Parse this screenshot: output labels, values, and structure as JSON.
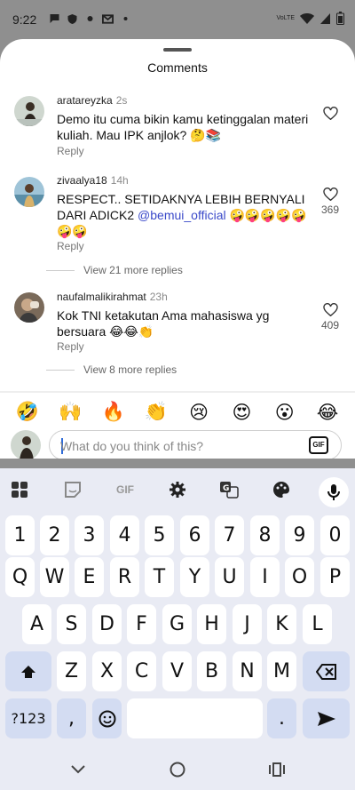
{
  "status_bar": {
    "time": "9:22",
    "network": "VoLTE",
    "left_icons": [
      "chat-icon",
      "vpn-icon",
      "dot-icon",
      "gmail-icon",
      "notification-dot-icon"
    ],
    "right_icons": [
      "volte-icon",
      "wifi-icon",
      "signal-icon",
      "battery-icon"
    ]
  },
  "sheet": {
    "title": "Comments"
  },
  "comments": [
    {
      "username": "aratareyzka",
      "time": "2s",
      "text": "Demo itu cuma bikin kamu ketinggalan materi kuliah. Mau IPK anjlok? 🤔📚",
      "mention": "",
      "reply_label": "Reply",
      "likes": "",
      "view_more": ""
    },
    {
      "username": "zivaalya18",
      "time": "14h",
      "text": "RESPECT.. SETIDAKNYA LEBIH BERNYALI DARI ADICK2 ",
      "mention": "@bemui_official",
      "text_after": " 🤪🤪🤪🤪🤪🤪🤪",
      "reply_label": "Reply",
      "likes": "369",
      "view_more": "View 21 more replies"
    },
    {
      "username": "naufalmalikirahmat",
      "time": "23h",
      "text": "Kok TNI ketakutan Ama mahasiswa yg bersuara 😂😂👏",
      "mention": "",
      "reply_label": "Reply",
      "likes": "409",
      "view_more": "View 8 more replies"
    }
  ],
  "emoji_bar": [
    "🤣",
    "🙌",
    "🔥",
    "👏",
    "😢",
    "😍",
    "😮",
    "😂"
  ],
  "composer": {
    "placeholder": "What do you think of this?",
    "value": "",
    "gif_label": "GIF"
  },
  "keyboard": {
    "toolbar": [
      "apps-icon",
      "sticker-icon",
      "GIF",
      "settings-icon",
      "translate-icon",
      "theme-icon",
      "mic-icon"
    ],
    "gif_label": "GIF",
    "rows": [
      [
        "1",
        "2",
        "3",
        "4",
        "5",
        "6",
        "7",
        "8",
        "9",
        "0"
      ],
      [
        "Q",
        "W",
        "E",
        "R",
        "T",
        "Y",
        "U",
        "I",
        "O",
        "P"
      ],
      [
        "A",
        "S",
        "D",
        "F",
        "G",
        "H",
        "J",
        "K",
        "L"
      ],
      [
        "shift-icon",
        "Z",
        "X",
        "C",
        "V",
        "B",
        "N",
        "M",
        "backspace-icon"
      ],
      [
        "?123",
        ",",
        "emoji-icon",
        "space",
        ".",
        "send-icon"
      ]
    ],
    "symbols_label": "?123",
    "comma_label": ",",
    "period_label": "."
  },
  "nav_bar": [
    "back-icon",
    "home-icon",
    "recents-icon"
  ],
  "colors": {
    "mention": "#3a49c9",
    "keyboard_bg": "#e9ebf4",
    "special_key": "#d3dcf2",
    "caret": "#2f6bd8"
  }
}
